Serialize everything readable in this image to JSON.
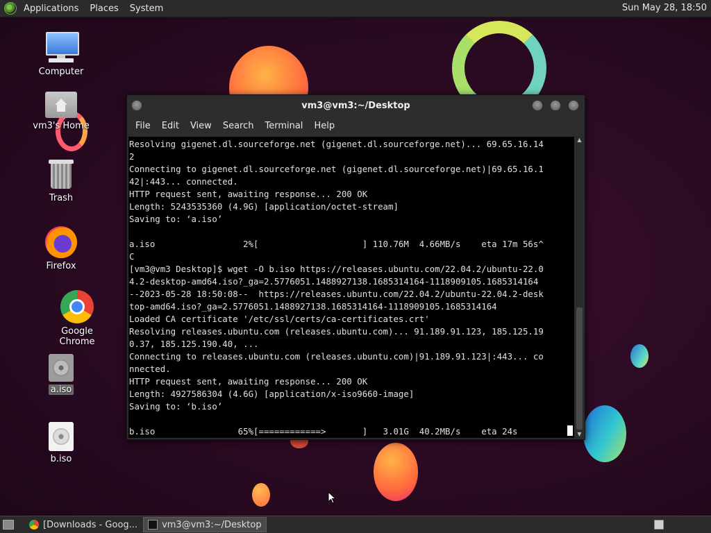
{
  "top_panel": {
    "menus": [
      "Applications",
      "Places",
      "System"
    ],
    "clock": "Sun May 28, 18:50"
  },
  "desktop_icons": [
    {
      "label": "Computer",
      "icon": "computer-icon"
    },
    {
      "label": "vm3's Home",
      "icon": "home-folder-icon"
    },
    {
      "label": "Trash",
      "icon": "trash-icon"
    },
    {
      "label": "Firefox",
      "icon": "firefox-icon"
    },
    {
      "label": "Google Chrome",
      "icon": "chrome-icon"
    },
    {
      "label": "a.iso",
      "icon": "disc-image-icon"
    },
    {
      "label": "b.iso",
      "icon": "disc-image-icon"
    }
  ],
  "terminal": {
    "title": "vm3@vm3:~/Desktop",
    "menu": [
      "File",
      "Edit",
      "View",
      "Search",
      "Terminal",
      "Help"
    ],
    "lines": [
      "Resolving gigenet.dl.sourceforge.net (gigenet.dl.sourceforge.net)... 69.65.16.14",
      "2",
      "Connecting to gigenet.dl.sourceforge.net (gigenet.dl.sourceforge.net)|69.65.16.1",
      "42|:443... connected.",
      "HTTP request sent, awaiting response... 200 OK",
      "Length: 5243535360 (4.9G) [application/octet-stream]",
      "Saving to: ‘a.iso’",
      "",
      "a.iso                 2%[                    ] 110.76M  4.66MB/s    eta 17m 56s^",
      "C",
      "[vm3@vm3 Desktop]$ wget -O b.iso https://releases.ubuntu.com/22.04.2/ubuntu-22.0",
      "4.2-desktop-amd64.iso?_ga=2.5776051.1488927138.1685314164-1118909105.1685314164",
      "--2023-05-28 18:50:08--  https://releases.ubuntu.com/22.04.2/ubuntu-22.04.2-desk",
      "top-amd64.iso?_ga=2.5776051.1488927138.1685314164-1118909105.1685314164",
      "Loaded CA certificate '/etc/ssl/certs/ca-certificates.crt'",
      "Resolving releases.ubuntu.com (releases.ubuntu.com)... 91.189.91.123, 185.125.19",
      "0.37, 185.125.190.40, ...",
      "Connecting to releases.ubuntu.com (releases.ubuntu.com)|91.189.91.123|:443... co",
      "nnected.",
      "HTTP request sent, awaiting response... 200 OK",
      "Length: 4927586304 (4.6G) [application/x-iso9660-image]",
      "Saving to: ‘b.iso’",
      "",
      "b.iso                65%[============>       ]   3.01G  40.2MB/s    eta 24s"
    ]
  },
  "taskbar": {
    "tasks": [
      {
        "label": "[Downloads - Goog...",
        "icon": "chrome-icon",
        "active": false
      },
      {
        "label": "vm3@vm3:~/Desktop",
        "icon": "terminal-icon",
        "active": true
      }
    ]
  }
}
